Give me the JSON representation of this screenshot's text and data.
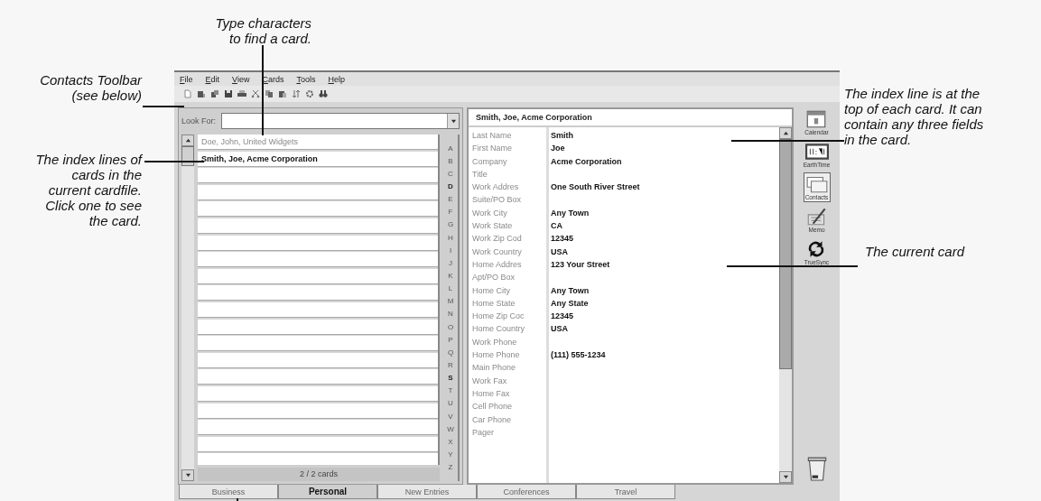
{
  "callouts": {
    "top": "Type characters\nto find a card.",
    "toolbar": "Contacts Toolbar\n(see below)",
    "index_lines": "The index lines of\ncards in the\ncurrent cardfile.\nClick one to see\nthe card.",
    "index_line": "The index line is at the\ntop of each card. It can\ncontain any three fields\nin the card.",
    "current_card": "The current card"
  },
  "menu": [
    "File",
    "Edit",
    "View",
    "Cards",
    "Tools",
    "Help"
  ],
  "toolbar": [
    {
      "kind": "page"
    },
    {
      "kind": "card"
    },
    {
      "kind": "cards"
    },
    {
      "kind": "disk"
    },
    {
      "kind": "printer"
    },
    {
      "kind": "scissors"
    },
    {
      "kind": "copy"
    },
    {
      "kind": "paste"
    },
    {
      "kind": "sort"
    },
    {
      "kind": "gear"
    },
    {
      "kind": "binoculars"
    }
  ],
  "look_for": {
    "label": "Look For:"
  },
  "index_rows": [
    {
      "text": "Doe, John, United Widgets",
      "selected": false
    },
    {
      "text": "Smith, Joe, Acme Corporation",
      "selected": true
    }
  ],
  "alphabet": [
    {
      "letter": "A",
      "has_cards": false
    },
    {
      "letter": "B",
      "has_cards": false
    },
    {
      "letter": "C",
      "has_cards": false
    },
    {
      "letter": "D",
      "has_cards": true
    },
    {
      "letter": "E",
      "has_cards": false
    },
    {
      "letter": "F",
      "has_cards": false
    },
    {
      "letter": "G",
      "has_cards": false
    },
    {
      "letter": "H",
      "has_cards": false
    },
    {
      "letter": "I",
      "has_cards": false
    },
    {
      "letter": "J",
      "has_cards": false
    },
    {
      "letter": "K",
      "has_cards": false
    },
    {
      "letter": "L",
      "has_cards": false
    },
    {
      "letter": "M",
      "has_cards": false
    },
    {
      "letter": "N",
      "has_cards": false
    },
    {
      "letter": "O",
      "has_cards": false
    },
    {
      "letter": "P",
      "has_cards": false
    },
    {
      "letter": "Q",
      "has_cards": false
    },
    {
      "letter": "R",
      "has_cards": false
    },
    {
      "letter": "S",
      "has_cards": true
    },
    {
      "letter": "T",
      "has_cards": false
    },
    {
      "letter": "U",
      "has_cards": false
    },
    {
      "letter": "V",
      "has_cards": false
    },
    {
      "letter": "W",
      "has_cards": false
    },
    {
      "letter": "X",
      "has_cards": false
    },
    {
      "letter": "Y",
      "has_cards": false
    },
    {
      "letter": "Z",
      "has_cards": false
    }
  ],
  "card_count": "2 / 2 cards",
  "card": {
    "index_line": "Smith, Joe, Acme Corporation",
    "fields": [
      {
        "label": "Last Name",
        "value": "Smith"
      },
      {
        "label": "First Name",
        "value": "Joe"
      },
      {
        "label": "Company",
        "value": "Acme Corporation"
      },
      {
        "label": "Title"
      },
      {
        "label": "Work Addres",
        "value": "One South River Street"
      },
      {
        "label": "Suite/PO Box"
      },
      {
        "label": "Work City",
        "value": "Any Town"
      },
      {
        "label": "Work State",
        "value": "CA"
      },
      {
        "label": "Work Zip Cod",
        "value": "12345"
      },
      {
        "label": "Work Country",
        "value": "USA"
      },
      {
        "label": "Home Addres",
        "value": "123 Your Street"
      },
      {
        "label": "Apt/PO Box"
      },
      {
        "label": "Home City",
        "value": "Any Town"
      },
      {
        "label": "Home State",
        "value": "Any State"
      },
      {
        "label": "Home Zip Coc",
        "value": "12345"
      },
      {
        "label": "Home Country",
        "value": "USA"
      },
      {
        "label": "Work Phone"
      },
      {
        "label": "Home Phone",
        "value": "(111) 555-1234"
      },
      {
        "label": "Main Phone"
      },
      {
        "label": "Work Fax"
      },
      {
        "label": "Home Fax"
      },
      {
        "label": "Cell Phone"
      },
      {
        "label": "Car Phone"
      },
      {
        "label": "Pager"
      }
    ]
  },
  "launcher": [
    {
      "kind": "calendar",
      "label": "Calendar",
      "selected": false
    },
    {
      "kind": "clock",
      "label": "EarthTime",
      "selected": false
    },
    {
      "kind": "contacts",
      "label": "Contacts",
      "selected": true
    },
    {
      "kind": "memo",
      "label": "Memo",
      "selected": false
    },
    {
      "kind": "sync",
      "label": "TrueSync",
      "selected": false
    },
    {
      "kind": "trash"
    }
  ],
  "tabs": [
    {
      "label": "Business",
      "selected": false
    },
    {
      "label": "Personal",
      "selected": true
    },
    {
      "label": "New Entries",
      "selected": false
    },
    {
      "label": "Conferences",
      "selected": false
    },
    {
      "label": "Travel",
      "selected": false
    }
  ]
}
